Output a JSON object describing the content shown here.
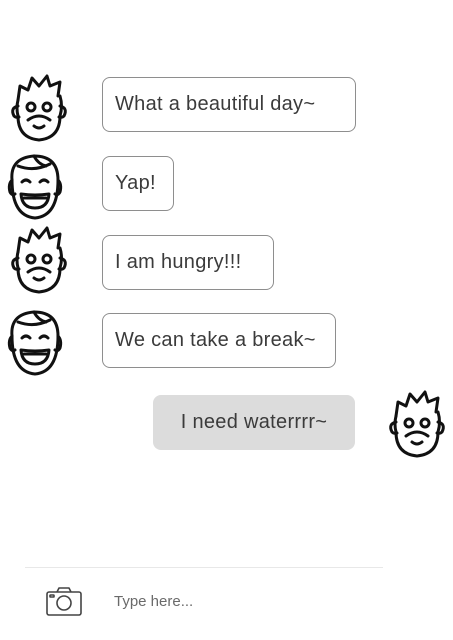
{
  "messages": [
    {
      "avatar": "bearded-man-icon",
      "direction": "incoming",
      "text": "What a beautiful day~"
    },
    {
      "avatar": "smiling-man-icon",
      "direction": "incoming",
      "text": "Yap!"
    },
    {
      "avatar": "bearded-man-icon",
      "direction": "incoming",
      "text": "I am hungry!!!"
    },
    {
      "avatar": "smiling-man-icon",
      "direction": "incoming",
      "text": "We can take a break~"
    },
    {
      "avatar": "bearded-man-icon",
      "direction": "outgoing",
      "text": "I need waterrrr~"
    }
  ],
  "composer": {
    "camera_icon": "camera-icon",
    "placeholder": "Type here..."
  },
  "colors": {
    "bubble_border": "#8e8e8e",
    "outgoing_bubble": "#dcdcdc",
    "text": "#3b3b3b"
  }
}
